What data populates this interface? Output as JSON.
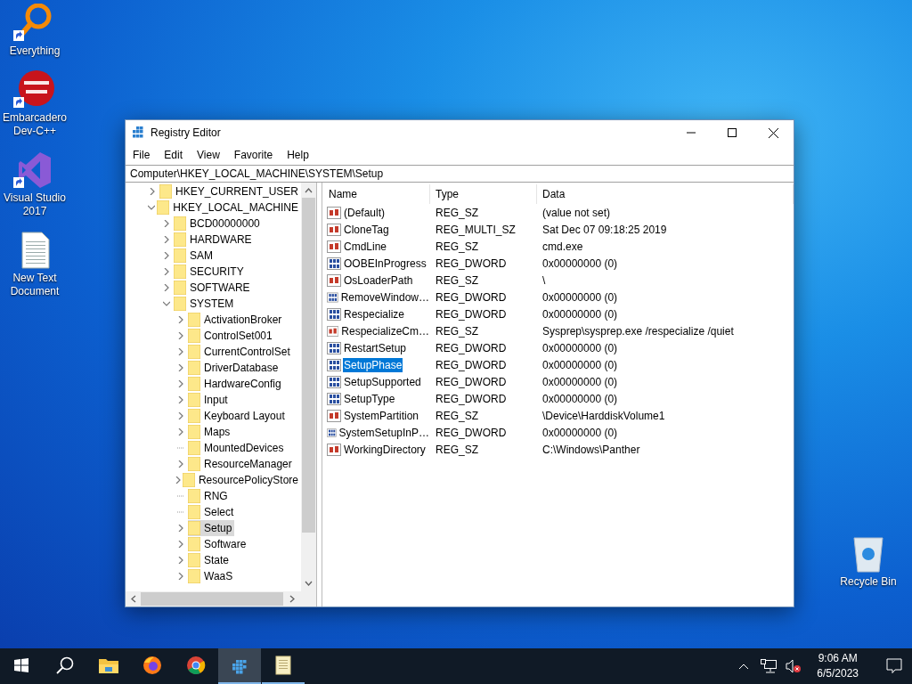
{
  "desktop_icons": [
    {
      "label": "Everything",
      "kind": "everything",
      "shortcut": true
    },
    {
      "label": "Embarcadero Dev-C++",
      "kind": "devcpp",
      "shortcut": true
    },
    {
      "label": "Visual Studio 2017",
      "kind": "vs",
      "shortcut": true
    },
    {
      "label": "New Text Document",
      "kind": "textdoc",
      "shortcut": false
    }
  ],
  "recycle_bin": {
    "label": "Recycle Bin"
  },
  "window": {
    "title": "Registry Editor",
    "menu": [
      "File",
      "Edit",
      "View",
      "Favorite",
      "Help"
    ],
    "address": "Computer\\HKEY_LOCAL_MACHINE\\SYSTEM\\Setup",
    "tree": [
      {
        "label": "HKEY_CURRENT_USER",
        "leaf": false,
        "expanded": false,
        "selected": false
      },
      {
        "label": "HKEY_LOCAL_MACHINE",
        "leaf": false,
        "expanded": true,
        "selected": false,
        "children": [
          {
            "label": "BCD00000000",
            "leaf": false,
            "expanded": false,
            "selected": false
          },
          {
            "label": "HARDWARE",
            "leaf": false,
            "expanded": false,
            "selected": false
          },
          {
            "label": "SAM",
            "leaf": false,
            "expanded": false,
            "selected": false
          },
          {
            "label": "SECURITY",
            "leaf": false,
            "expanded": false,
            "selected": false
          },
          {
            "label": "SOFTWARE",
            "leaf": false,
            "expanded": false,
            "selected": false
          },
          {
            "label": "SYSTEM",
            "leaf": false,
            "expanded": true,
            "selected": false,
            "children": [
              {
                "label": "ActivationBroker",
                "leaf": false,
                "expanded": false,
                "selected": false
              },
              {
                "label": "ControlSet001",
                "leaf": false,
                "expanded": false,
                "selected": false
              },
              {
                "label": "CurrentControlSet",
                "leaf": false,
                "expanded": false,
                "selected": false
              },
              {
                "label": "DriverDatabase",
                "leaf": false,
                "expanded": false,
                "selected": false
              },
              {
                "label": "HardwareConfig",
                "leaf": false,
                "expanded": false,
                "selected": false
              },
              {
                "label": "Input",
                "leaf": false,
                "expanded": false,
                "selected": false
              },
              {
                "label": "Keyboard Layout",
                "leaf": false,
                "expanded": false,
                "selected": false
              },
              {
                "label": "Maps",
                "leaf": false,
                "expanded": false,
                "selected": false
              },
              {
                "label": "MountedDevices",
                "leaf": true,
                "expanded": false,
                "selected": false
              },
              {
                "label": "ResourceManager",
                "leaf": false,
                "expanded": false,
                "selected": false
              },
              {
                "label": "ResourcePolicyStore",
                "leaf": false,
                "expanded": false,
                "selected": false
              },
              {
                "label": "RNG",
                "leaf": true,
                "expanded": false,
                "selected": false
              },
              {
                "label": "Select",
                "leaf": true,
                "expanded": false,
                "selected": false
              },
              {
                "label": "Setup",
                "leaf": false,
                "expanded": false,
                "selected": true
              },
              {
                "label": "Software",
                "leaf": false,
                "expanded": false,
                "selected": false
              },
              {
                "label": "State",
                "leaf": false,
                "expanded": false,
                "selected": false
              },
              {
                "label": "WaaS",
                "leaf": false,
                "expanded": false,
                "selected": false
              }
            ]
          }
        ]
      }
    ],
    "columns": [
      "Name",
      "Type",
      "Data"
    ],
    "values": [
      {
        "name": "(Default)",
        "type": "REG_SZ",
        "data": "(value not set)",
        "kind": "string",
        "selected": false
      },
      {
        "name": "CloneTag",
        "type": "REG_MULTI_SZ",
        "data": "Sat Dec 07 09:18:25 2019",
        "kind": "string",
        "selected": false
      },
      {
        "name": "CmdLine",
        "type": "REG_SZ",
        "data": "cmd.exe",
        "kind": "string",
        "selected": false
      },
      {
        "name": "OOBEInProgress",
        "type": "REG_DWORD",
        "data": "0x00000000 (0)",
        "kind": "binary",
        "selected": false
      },
      {
        "name": "OsLoaderPath",
        "type": "REG_SZ",
        "data": "\\",
        "kind": "string",
        "selected": false
      },
      {
        "name": "RemoveWindow…",
        "type": "REG_DWORD",
        "data": "0x00000000 (0)",
        "kind": "binary",
        "selected": false
      },
      {
        "name": "Respecialize",
        "type": "REG_DWORD",
        "data": "0x00000000 (0)",
        "kind": "binary",
        "selected": false
      },
      {
        "name": "RespecializeCm…",
        "type": "REG_SZ",
        "data": "Sysprep\\sysprep.exe /respecialize /quiet",
        "kind": "string",
        "selected": false
      },
      {
        "name": "RestartSetup",
        "type": "REG_DWORD",
        "data": "0x00000000 (0)",
        "kind": "binary",
        "selected": false
      },
      {
        "name": "SetupPhase",
        "type": "REG_DWORD",
        "data": "0x00000000 (0)",
        "kind": "binary",
        "selected": true
      },
      {
        "name": "SetupSupported",
        "type": "REG_DWORD",
        "data": "0x00000000 (0)",
        "kind": "binary",
        "selected": false
      },
      {
        "name": "SetupType",
        "type": "REG_DWORD",
        "data": "0x00000000 (0)",
        "kind": "binary",
        "selected": false
      },
      {
        "name": "SystemPartition",
        "type": "REG_SZ",
        "data": "\\Device\\HarddiskVolume1",
        "kind": "string",
        "selected": false
      },
      {
        "name": "SystemSetupInP…",
        "type": "REG_DWORD",
        "data": "0x00000000 (0)",
        "kind": "binary",
        "selected": false
      },
      {
        "name": "WorkingDirectory",
        "type": "REG_SZ",
        "data": "C:\\Windows\\Panther",
        "kind": "string",
        "selected": false
      }
    ]
  },
  "taskbar": {
    "apps": [
      {
        "kind": "start",
        "active": false,
        "running": false
      },
      {
        "kind": "search",
        "active": false,
        "running": false
      },
      {
        "kind": "explorer",
        "active": false,
        "running": false
      },
      {
        "kind": "firefox",
        "active": false,
        "running": false
      },
      {
        "kind": "chrome",
        "active": false,
        "running": false
      },
      {
        "kind": "regedit",
        "active": true,
        "running": true
      },
      {
        "kind": "notepad",
        "active": false,
        "running": true
      }
    ],
    "time": "9:06 AM",
    "date": "6/5/2023"
  }
}
